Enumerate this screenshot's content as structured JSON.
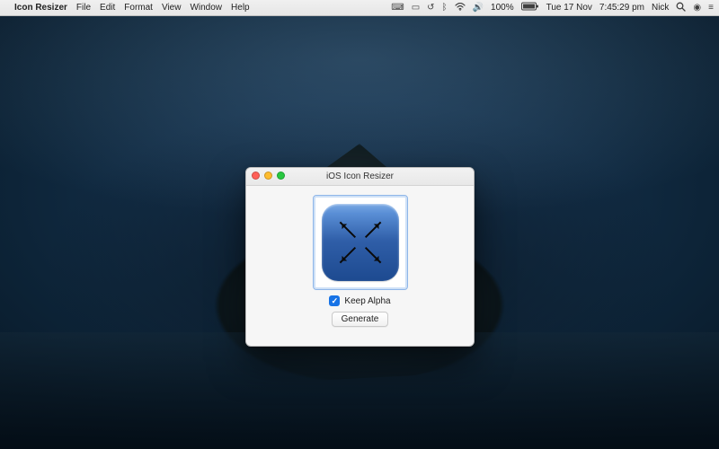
{
  "menubar": {
    "app_name": "Icon Resizer",
    "items": [
      "File",
      "Edit",
      "Format",
      "View",
      "Window",
      "Help"
    ],
    "right": {
      "battery_text": "100%",
      "date_text": "Tue 17 Nov",
      "time_text": "7:45:29 pm",
      "user_name": "Nick"
    }
  },
  "window": {
    "title": "iOS Icon Resizer",
    "keep_alpha_label": "Keep Alpha",
    "keep_alpha_checked": true,
    "generate_label": "Generate",
    "icon_name": "expand-arrows-icon"
  },
  "colors": {
    "accent": "#1773e6"
  }
}
